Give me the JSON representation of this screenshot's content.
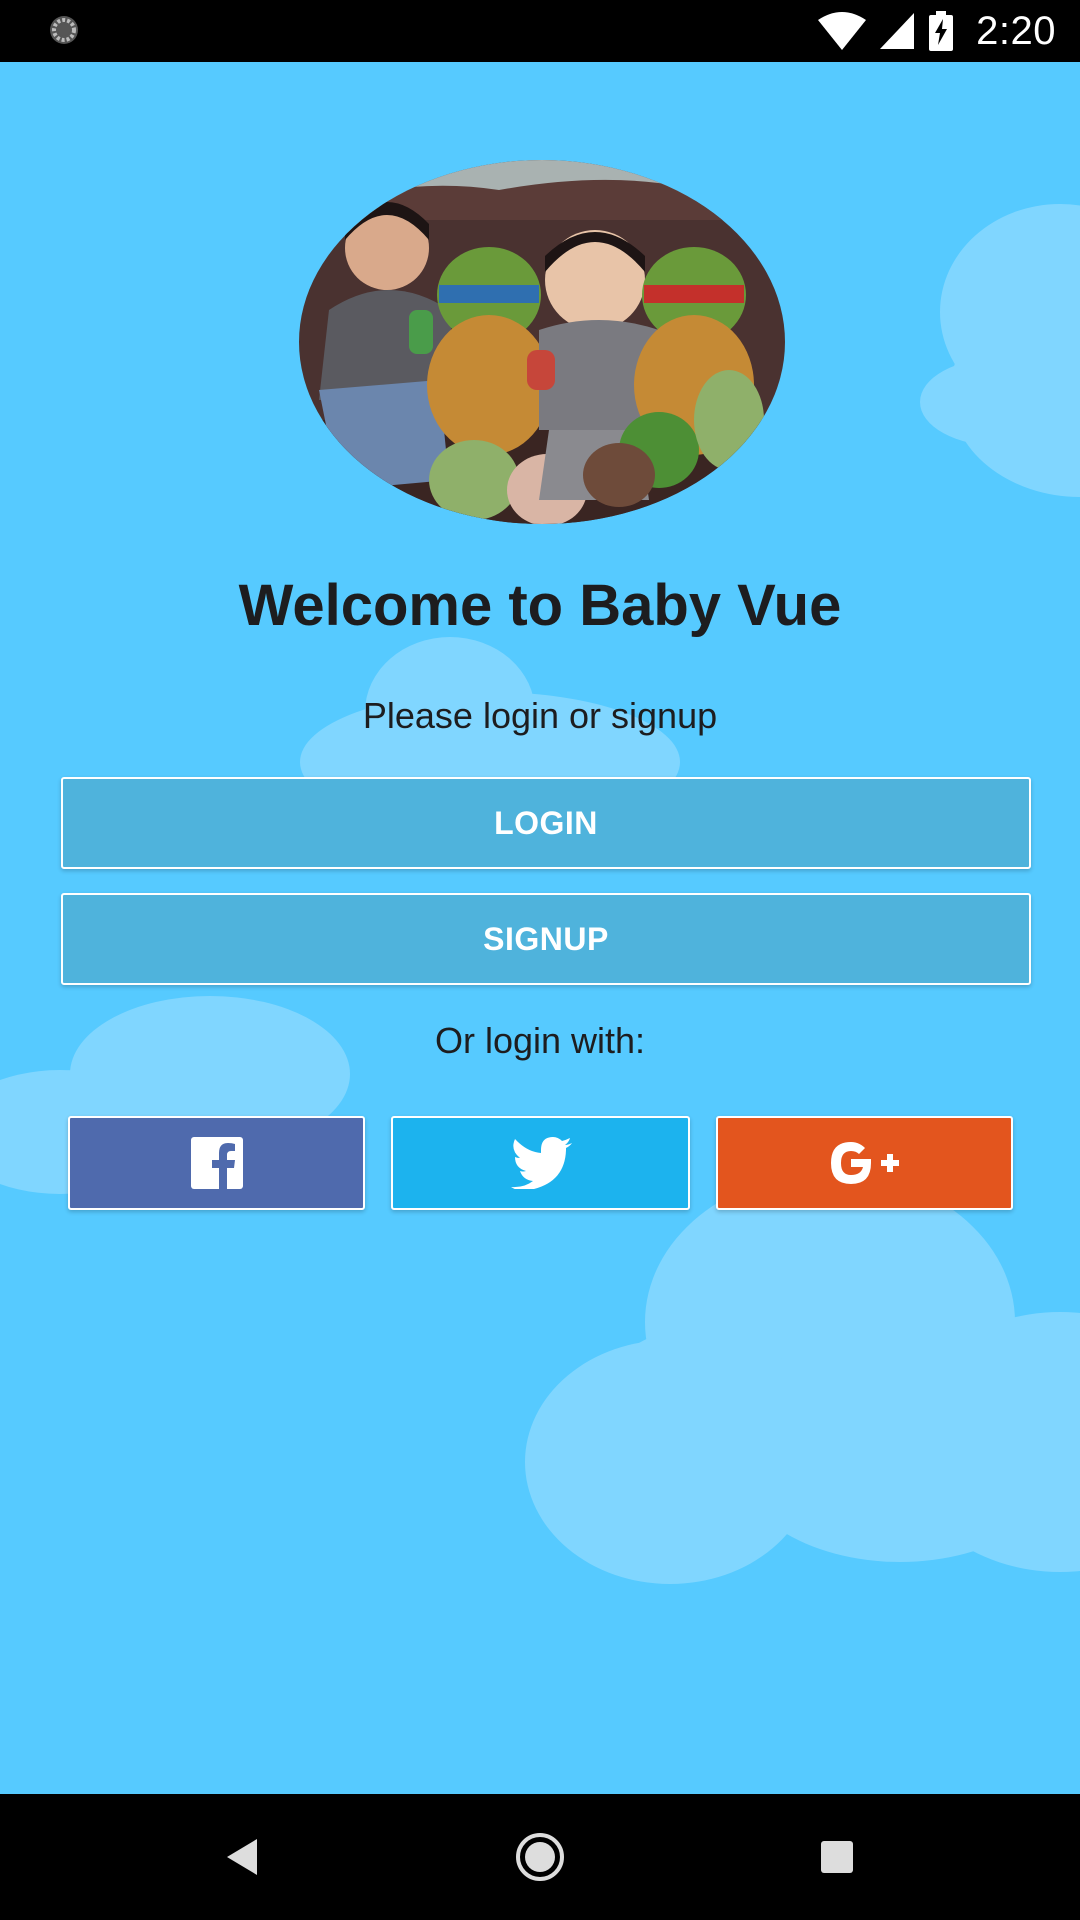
{
  "status_bar": {
    "time": "2:20",
    "icons": [
      "loading-spinner-icon",
      "wifi-icon",
      "cell-signal-icon",
      "battery-charging-icon"
    ]
  },
  "app": {
    "background_color": "#56caff",
    "title": "Welcome to Baby Vue",
    "subtitle": "Please login or signup",
    "login_label": "LOGIN",
    "signup_label": "SIGNUP",
    "or_login_with": "Or login with:",
    "social": [
      {
        "name": "facebook",
        "icon": "facebook-icon",
        "color": "#4f6aad"
      },
      {
        "name": "twitter",
        "icon": "twitter-icon",
        "color": "#1cb3ee"
      },
      {
        "name": "google-plus",
        "icon": "google-plus-icon",
        "color": "#e3551e"
      }
    ]
  },
  "nav_bar": {
    "buttons": [
      "back-icon",
      "home-icon",
      "recent-apps-icon"
    ]
  }
}
